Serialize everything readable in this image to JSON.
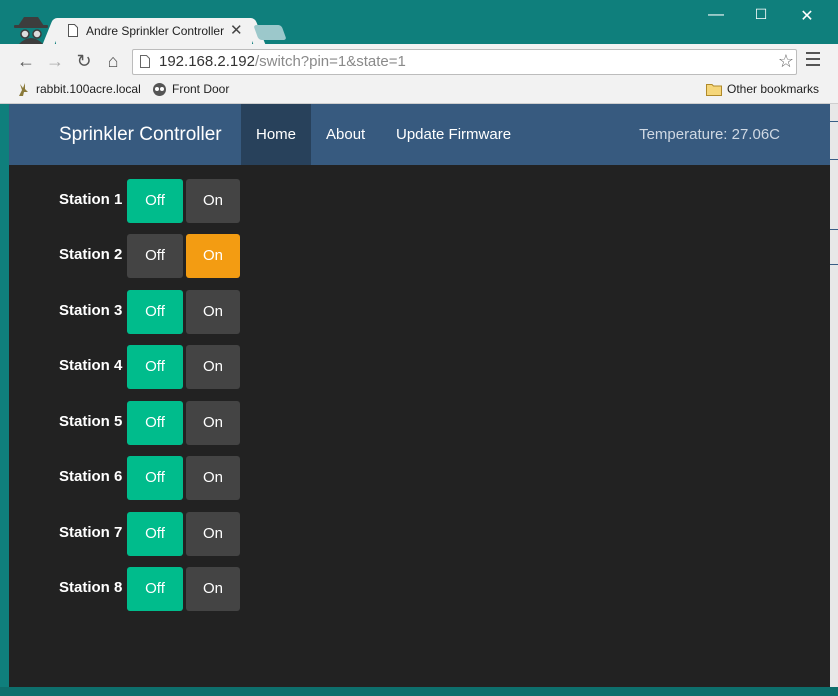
{
  "browser": {
    "tab_title": "Andre Sprinkler Controller",
    "tab_close": "✕",
    "url_host": "192.168.2.192",
    "url_path": "/switch?pin=1&state=1",
    "window_controls": {
      "minimize": "—",
      "maximize": "☐",
      "close": "✕"
    },
    "nav": {
      "back": "←",
      "forward": "→",
      "reload": "↻",
      "home": "⌂",
      "star": "☆"
    },
    "bookmarks": [
      {
        "label": "rabbit.100acre.local",
        "icon": "rabbit-icon"
      },
      {
        "label": "Front Door",
        "icon": "owl-icon"
      }
    ],
    "other_bookmarks": "Other bookmarks"
  },
  "page": {
    "brand": "Sprinkler Controller",
    "nav": [
      {
        "label": "Home",
        "active": true
      },
      {
        "label": "About",
        "active": false
      },
      {
        "label": "Update Firmware",
        "active": false
      }
    ],
    "temperature": "Temperature: 27.06C",
    "off_label": "Off",
    "on_label": "On",
    "stations": [
      {
        "label": "Station 1",
        "state": "off"
      },
      {
        "label": "Station 2",
        "state": "on"
      },
      {
        "label": "Station 3",
        "state": "off"
      },
      {
        "label": "Station 4",
        "state": "off"
      },
      {
        "label": "Station 5",
        "state": "off"
      },
      {
        "label": "Station 6",
        "state": "off"
      },
      {
        "label": "Station 7",
        "state": "off"
      },
      {
        "label": "Station 8",
        "state": "off"
      }
    ]
  },
  "colors": {
    "navbar": "#375a7f",
    "off_active": "#00bc8c",
    "on_active": "#f39c12",
    "inactive": "#444444",
    "page_bg": "#222222"
  }
}
